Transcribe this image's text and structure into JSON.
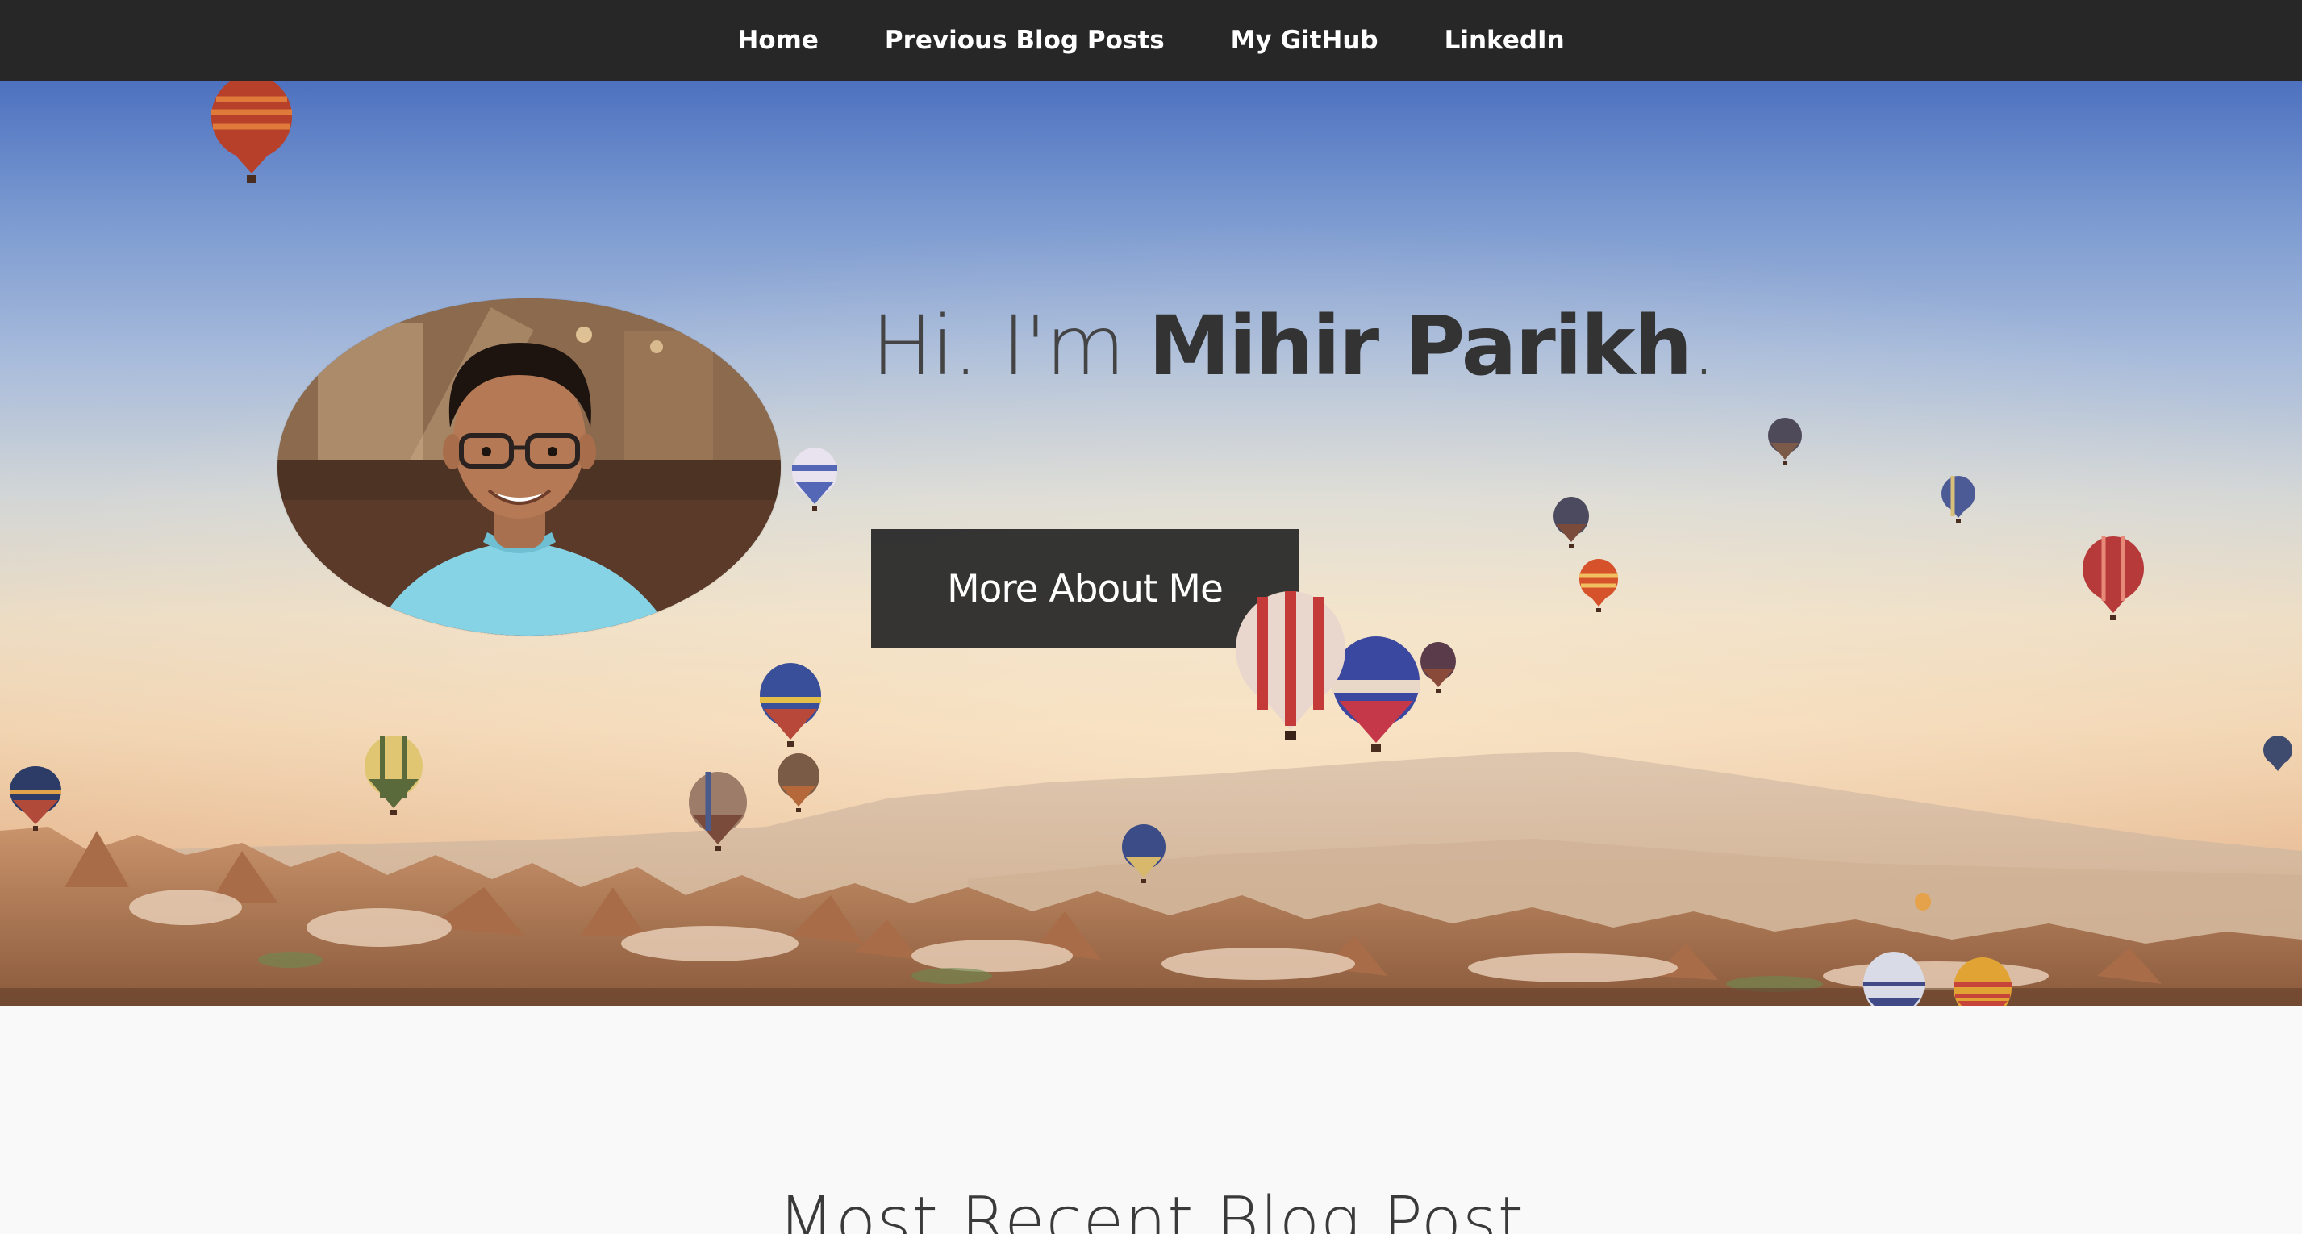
{
  "nav": {
    "items": [
      {
        "label": "Home"
      },
      {
        "label": "Previous Blog Posts"
      },
      {
        "label": "My GitHub"
      },
      {
        "label": "LinkedIn"
      }
    ]
  },
  "hero": {
    "greeting_prefix": "Hi. I'm ",
    "name": "Mihir Parikh",
    "greeting_suffix": ".",
    "cta_label": "More About Me",
    "avatar": "profile-photo"
  },
  "recent": {
    "title": "Most Recent Blog Post"
  },
  "colors": {
    "nav_bg": "#272727",
    "nav_text": "#ffffff",
    "button_bg": "#282828",
    "text_dark": "#3a3a3a",
    "page_bg": "#f9f9f9"
  }
}
